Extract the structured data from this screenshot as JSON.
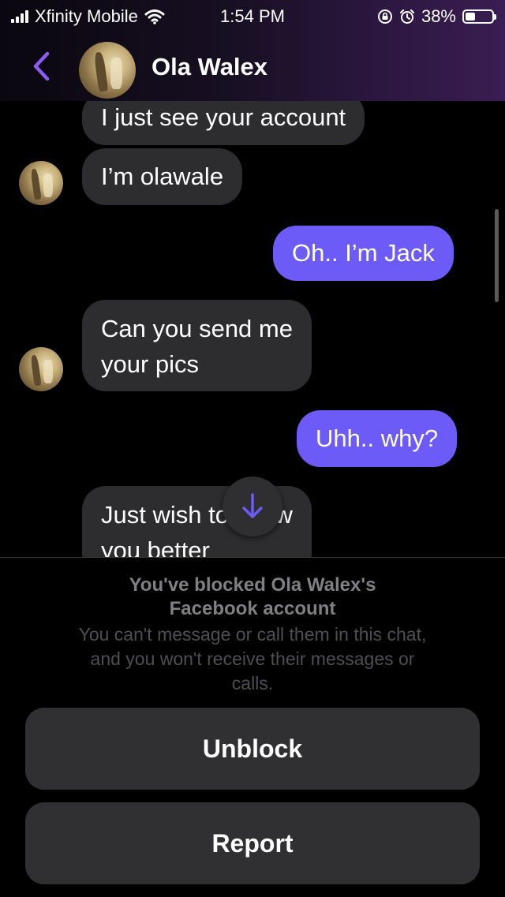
{
  "status_bar": {
    "carrier": "Xfinity Mobile",
    "time": "1:54 PM",
    "battery_percent": "38%",
    "battery_level": 0.38,
    "icons": [
      "signal-icon",
      "wifi-icon",
      "orientation-lock-icon",
      "alarm-icon",
      "battery-icon"
    ]
  },
  "header": {
    "contact_name": "Ola Walex",
    "back_icon": "chevron-left-icon",
    "accent_color": "#8b5cf6"
  },
  "messages": [
    {
      "direction": "received",
      "text": "I just see your account"
    },
    {
      "direction": "received",
      "text": "I’m olawale",
      "show_avatar": true
    },
    {
      "direction": "sent",
      "text": "Oh.. I’m Jack"
    },
    {
      "direction": "received",
      "lines": [
        "Can you send me",
        "your pics"
      ],
      "show_avatar": true
    },
    {
      "direction": "sent",
      "text": "Uhh.. why?"
    },
    {
      "direction": "received",
      "lines": [
        "Just wish to know",
        "you better"
      ]
    }
  ],
  "scroll_down_icon": "arrow-down-icon",
  "blocked_panel": {
    "title_line1": "You've blocked Ola Walex's",
    "title_line2": "Facebook account",
    "description_line1": "You can't message or call them in this chat,",
    "description_line2": "and you won't receive their messages or",
    "description_line3": "calls.",
    "unblock_label": "Unblock",
    "report_label": "Report"
  },
  "colors": {
    "sent_bubble": "#6d5bf7",
    "received_bubble": "#2d2d2f",
    "background": "#000000"
  }
}
